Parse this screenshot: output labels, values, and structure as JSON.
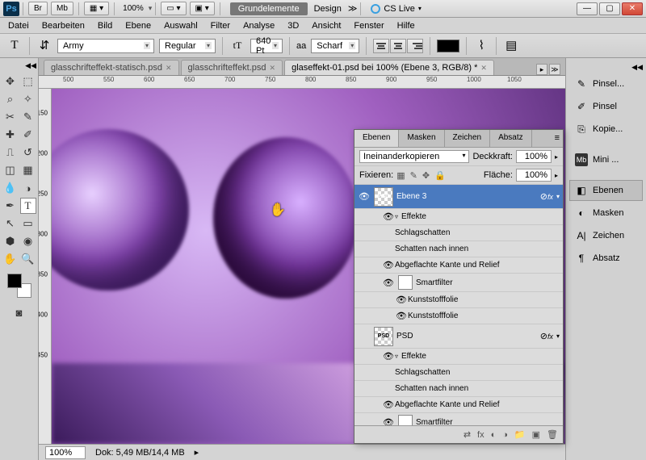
{
  "titlebar": {
    "br": "Br",
    "mb": "Mb",
    "zoom": "100%",
    "workspace_active": "Grundelemente",
    "workspace_other": "Design",
    "cslive": "CS Live"
  },
  "menu": [
    "Datei",
    "Bearbeiten",
    "Bild",
    "Ebene",
    "Auswahl",
    "Filter",
    "Analyse",
    "3D",
    "Ansicht",
    "Fenster",
    "Hilfe"
  ],
  "optbar": {
    "font_family": "Army",
    "font_style": "Regular",
    "font_size": "640 Pt",
    "aa_prefix": "aa",
    "aa_mode": "Scharf"
  },
  "doc_tabs": [
    {
      "label": "glasschrifteffekt-statisch.psd",
      "active": false
    },
    {
      "label": "glasschrifteffekt.psd",
      "active": false
    },
    {
      "label": "glaseffekt-01.psd bei 100% (Ebene 3, RGB/8) *",
      "active": true
    }
  ],
  "ruler_h": [
    "500",
    "550",
    "600",
    "650",
    "700",
    "750",
    "800",
    "850",
    "900",
    "950",
    "1000",
    "1050"
  ],
  "ruler_v": [
    "150",
    "200",
    "250",
    "300",
    "350",
    "400",
    "450"
  ],
  "status": {
    "zoom": "100%",
    "doc_info": "Dok: 5,49 MB/14,4 MB"
  },
  "layers": {
    "tabs": [
      "Ebenen",
      "Masken",
      "Zeichen",
      "Absatz"
    ],
    "blend_mode": "Ineinanderkopieren",
    "opacity_label": "Deckkraft:",
    "opacity_value": "100%",
    "lock_label": "Fixieren:",
    "fill_label": "Fläche:",
    "fill_value": "100%",
    "items": [
      {
        "name": "Ebene 3"
      },
      {
        "name": "Effekte"
      },
      {
        "name": "Schlagschatten"
      },
      {
        "name": "Schatten nach innen"
      },
      {
        "name": "Abgeflachte Kante und Relief"
      },
      {
        "name": "Smartfilter"
      },
      {
        "name": "Kunststofffolie"
      },
      {
        "name": "Kunststofffolie"
      },
      {
        "name": "PSD"
      },
      {
        "name": "Effekte"
      },
      {
        "name": "Schlagschatten"
      },
      {
        "name": "Schatten nach innen"
      },
      {
        "name": "Abgeflachte Kante und Relief"
      },
      {
        "name": "Smartfilter"
      }
    ],
    "fx_label": "fx"
  },
  "dock": {
    "items": [
      {
        "label": "Pinsel...",
        "icon": "✎"
      },
      {
        "label": "Pinsel",
        "icon": "✎"
      },
      {
        "label": "Kopie...",
        "icon": "⎘"
      },
      {
        "label": "Mini ...",
        "icon": "Mb",
        "badge": true
      },
      {
        "label": "Ebenen",
        "icon": "◧",
        "sel": true
      },
      {
        "label": "Masken",
        "icon": "◐"
      },
      {
        "label": "Zeichen",
        "icon": "A|"
      },
      {
        "label": "Absatz",
        "icon": "¶"
      }
    ]
  }
}
